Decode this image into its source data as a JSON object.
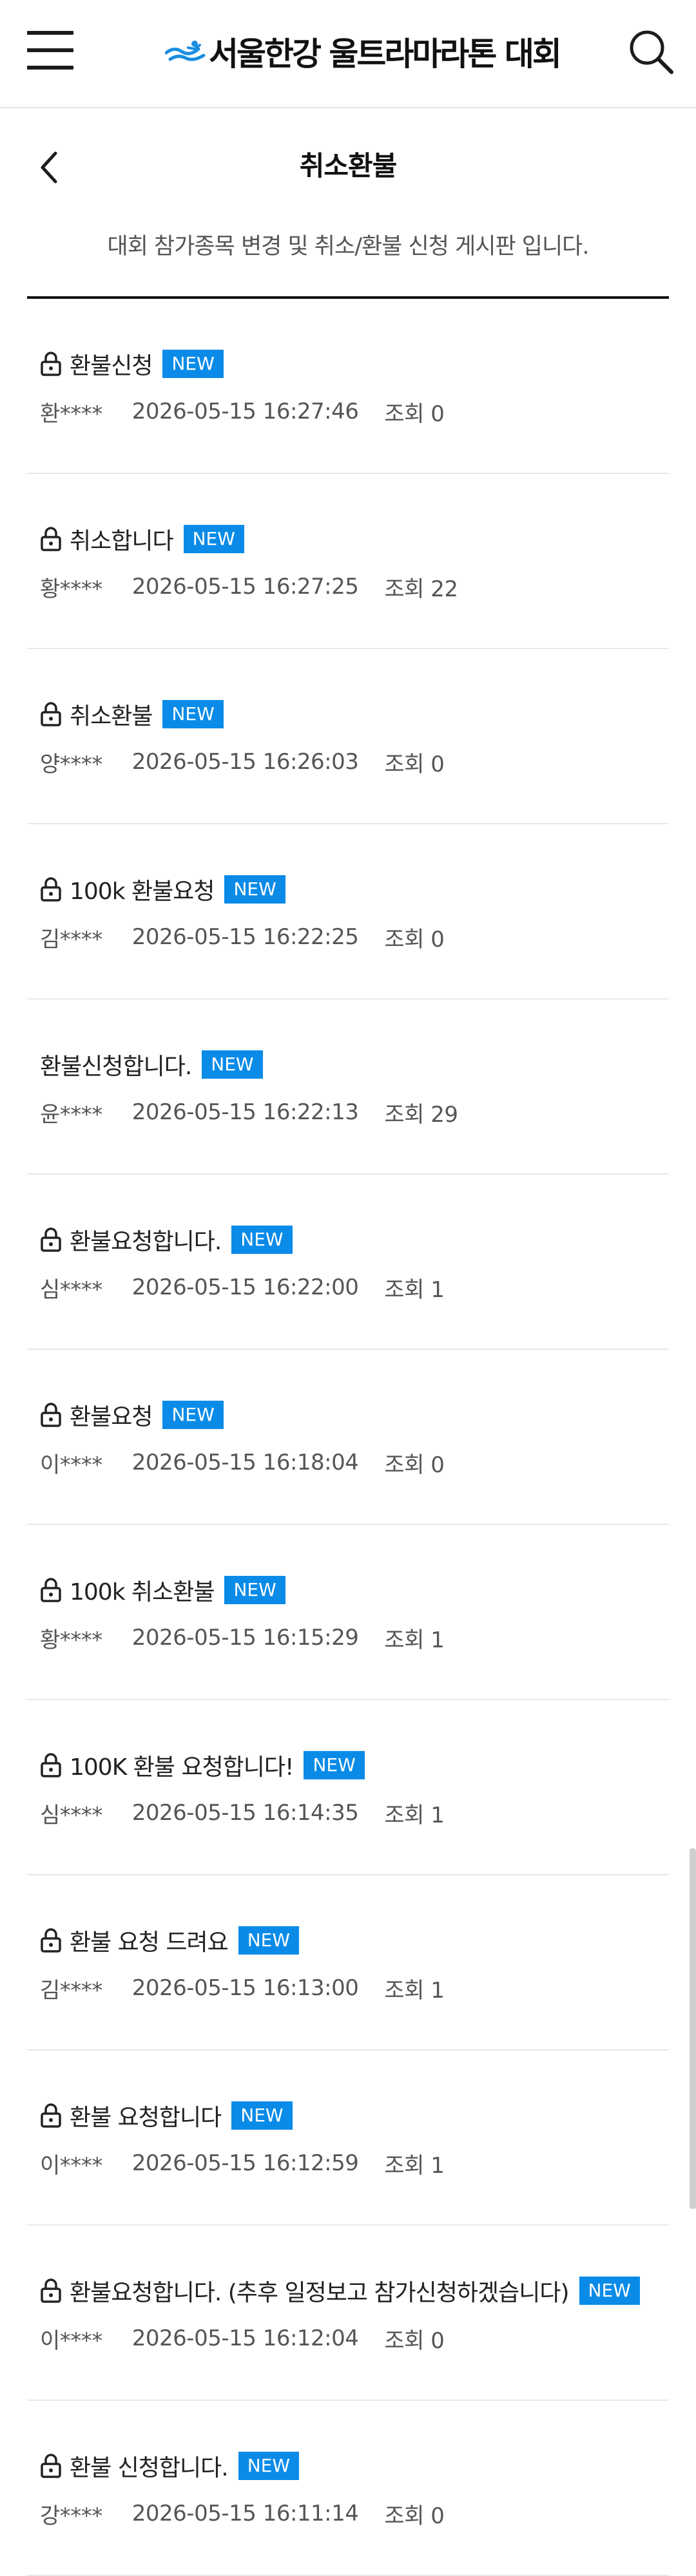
{
  "header": {
    "logo_text": "서울한강 울트라마라톤 대회",
    "logo_icon": "runner-wave-logo",
    "menu_icon": "hamburger-menu-icon",
    "search_icon": "search-icon",
    "brand_color": "#1a8ee0"
  },
  "page": {
    "back_icon": "chevron-left-icon",
    "title": "취소환불",
    "description": "대회 참가종목 변경 및 취소/환불 신청 게시판 입니다."
  },
  "badge_color": "#0a8be8",
  "posts": [
    {
      "locked": true,
      "title": "환불신청",
      "badge": "NEW",
      "author": "환****",
      "date": "2026-05-15 16:27:46",
      "views": "조회 0"
    },
    {
      "locked": true,
      "title": "취소합니다",
      "badge": "NEW",
      "author": "황****",
      "date": "2026-05-15 16:27:25",
      "views": "조회 22"
    },
    {
      "locked": true,
      "title": "취소환불",
      "badge": "NEW",
      "author": "양****",
      "date": "2026-05-15 16:26:03",
      "views": "조회 0"
    },
    {
      "locked": true,
      "title": "100k 환불요청",
      "badge": "NEW",
      "author": "김****",
      "date": "2026-05-15 16:22:25",
      "views": "조회 0"
    },
    {
      "locked": false,
      "title": "환불신청합니다.",
      "badge": "NEW",
      "author": "윤****",
      "date": "2026-05-15 16:22:13",
      "views": "조회 29"
    },
    {
      "locked": true,
      "title": "환불요청합니다.",
      "badge": "NEW",
      "author": "심****",
      "date": "2026-05-15 16:22:00",
      "views": "조회 1"
    },
    {
      "locked": true,
      "title": "환불요청",
      "badge": "NEW",
      "author": "이****",
      "date": "2026-05-15 16:18:04",
      "views": "조회 0"
    },
    {
      "locked": true,
      "title": "100k 취소환불",
      "badge": "NEW",
      "author": "황****",
      "date": "2026-05-15 16:15:29",
      "views": "조회 1"
    },
    {
      "locked": true,
      "title": "100K 환불 요청합니다!",
      "badge": "NEW",
      "author": "심****",
      "date": "2026-05-15 16:14:35",
      "views": "조회 1"
    },
    {
      "locked": true,
      "title": "환불 요청 드려요",
      "badge": "NEW",
      "author": "김****",
      "date": "2026-05-15 16:13:00",
      "views": "조회 1"
    },
    {
      "locked": true,
      "title": "환불 요청합니다",
      "badge": "NEW",
      "author": "이****",
      "date": "2026-05-15 16:12:59",
      "views": "조회 1"
    },
    {
      "locked": true,
      "title": "환불요청합니다. (추후 일정보고 참가신청하겠습니다)",
      "badge": "NEW",
      "author": "이****",
      "date": "2026-05-15 16:12:04",
      "views": "조회 0"
    },
    {
      "locked": true,
      "title": "환불 신청합니다.",
      "badge": "NEW",
      "author": "강****",
      "date": "2026-05-15 16:11:14",
      "views": "조회 0"
    }
  ]
}
